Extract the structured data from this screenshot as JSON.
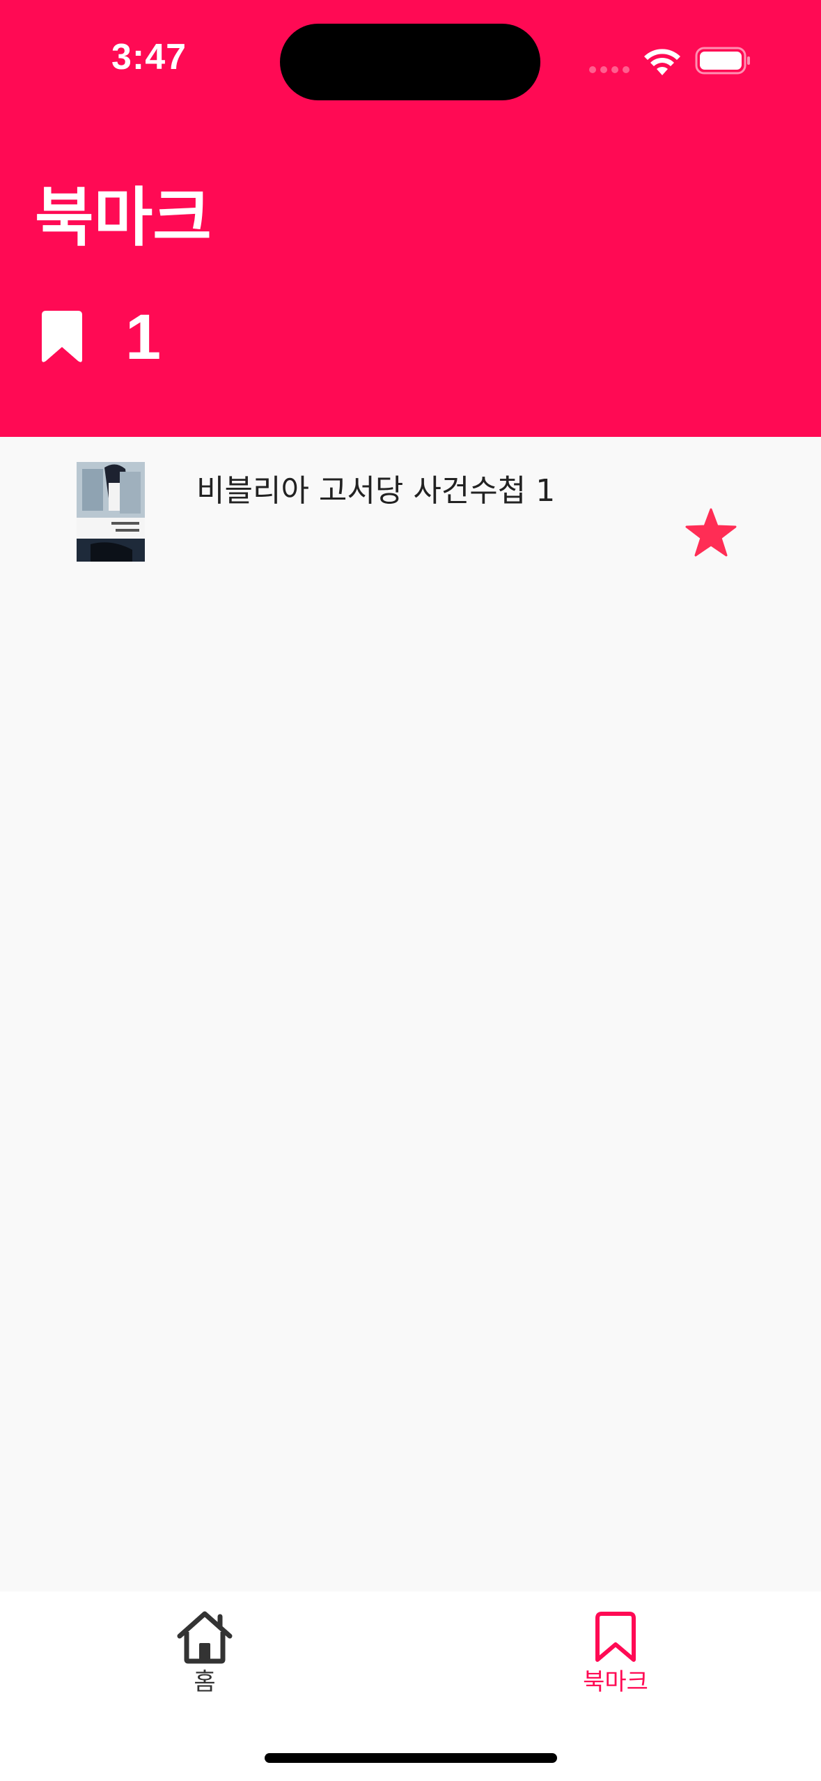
{
  "status_bar": {
    "time": "3:47"
  },
  "header": {
    "title": "북마크",
    "bookmark_count": "1",
    "background_color": "#ff0a54"
  },
  "bookmarks": [
    {
      "title": "비블리아 고서당 사건수첩 1",
      "starred": true,
      "star_color": "#ff2d55"
    }
  ],
  "tab_bar": {
    "tabs": [
      {
        "label": "홈",
        "icon": "home-icon",
        "active": false
      },
      {
        "label": "북마크",
        "icon": "bookmark-icon",
        "active": true
      }
    ],
    "active_color": "#ff0a54",
    "inactive_color": "#333333"
  }
}
